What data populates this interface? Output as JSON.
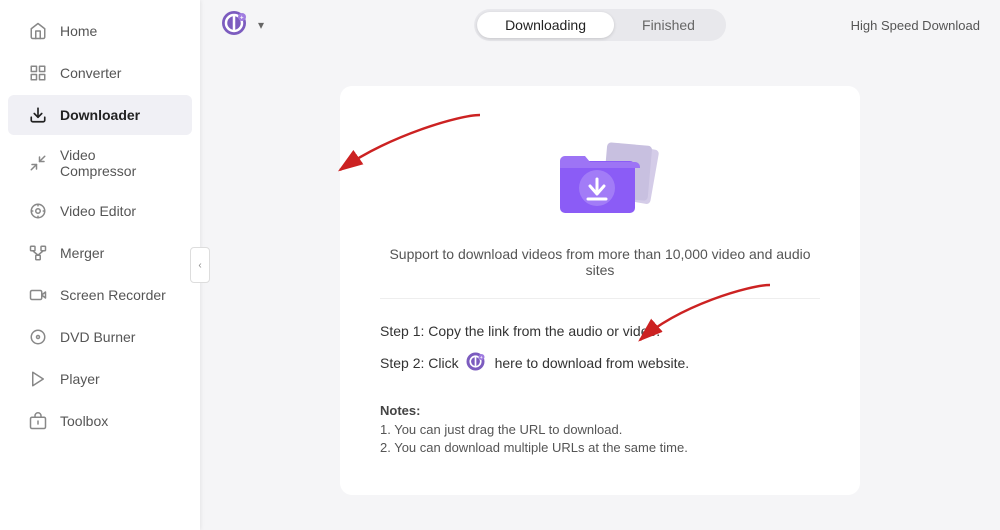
{
  "sidebar": {
    "items": [
      {
        "id": "home",
        "label": "Home",
        "icon": "home"
      },
      {
        "id": "converter",
        "label": "Converter",
        "icon": "converter"
      },
      {
        "id": "downloader",
        "label": "Downloader",
        "icon": "downloader",
        "active": true
      },
      {
        "id": "video-compressor",
        "label": "Video Compressor",
        "icon": "compress"
      },
      {
        "id": "video-editor",
        "label": "Video Editor",
        "icon": "edit"
      },
      {
        "id": "merger",
        "label": "Merger",
        "icon": "merge"
      },
      {
        "id": "screen-recorder",
        "label": "Screen Recorder",
        "icon": "record"
      },
      {
        "id": "dvd-burner",
        "label": "DVD Burner",
        "icon": "dvd"
      },
      {
        "id": "player",
        "label": "Player",
        "icon": "player"
      },
      {
        "id": "toolbox",
        "label": "Toolbox",
        "icon": "toolbox"
      }
    ]
  },
  "topbar": {
    "tabs": [
      {
        "id": "downloading",
        "label": "Downloading",
        "active": true
      },
      {
        "id": "finished",
        "label": "Finished",
        "active": false
      }
    ],
    "high_speed_label": "High Speed Download"
  },
  "main": {
    "support_text": "Support to download videos from more than 10,000 video and audio sites",
    "step1": "Step 1: Copy the link from the audio or video.",
    "step2_prefix": "Step 2: Click",
    "step2_suffix": "here to download from website.",
    "notes_title": "Notes:",
    "note1": "1. You can just drag the URL to download.",
    "note2": "2. You can download multiple URLs at the same time."
  }
}
